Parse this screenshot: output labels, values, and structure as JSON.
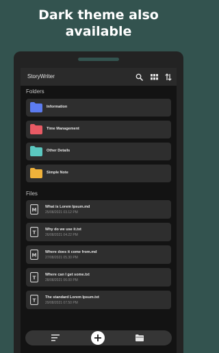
{
  "headline": {
    "line1": "Dark theme also",
    "line2": "available"
  },
  "app": {
    "title": "StoryWriter"
  },
  "icons": {
    "search": "search-icon",
    "view": "grid-view-icon",
    "sort": "sort-icon",
    "list": "list-icon",
    "add": "plus-icon",
    "folder": "folder-open-icon"
  },
  "sections": {
    "folders": "Folders",
    "files": "Files"
  },
  "folders": [
    {
      "name": "Information",
      "color": "#5c7cf0"
    },
    {
      "name": "Time Management",
      "color": "#e85a64"
    },
    {
      "name": "Other Details",
      "color": "#5bc8c0"
    },
    {
      "name": "Simple Note",
      "color": "#f0b23a"
    }
  ],
  "files": [
    {
      "name": "What is Lorem Ipsum.md",
      "date": "25/08/2021 03.12 PM",
      "type": "M"
    },
    {
      "name": "Why do we use it.txt",
      "date": "26/08/2021 04.22 PM",
      "type": "T"
    },
    {
      "name": "Where does it come from.md",
      "date": "27/08/2021 05.30 PM",
      "type": "M"
    },
    {
      "name": "Where can I get some.txt",
      "date": "28/08/2021 06.00 PM",
      "type": "T"
    },
    {
      "name": "The standard Lorem Ipsum.txt",
      "date": "29/08/2021 07.50 PM",
      "type": "T"
    }
  ]
}
